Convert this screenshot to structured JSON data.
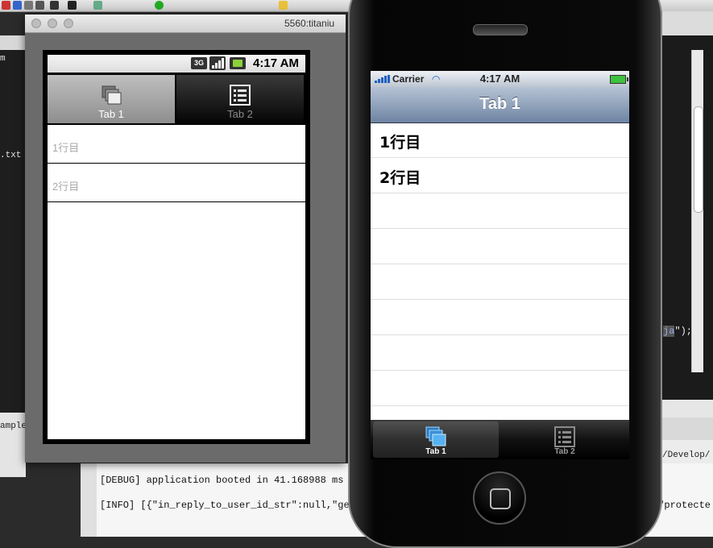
{
  "ide": {
    "left_panel_items": [
      "m",
      ".txt",
      "amples"
    ],
    "code_fragment": {
      "highlight": "ja",
      "rest": "\");"
    },
    "path_fragment": "/Develop/",
    "console": {
      "debug_line": "[DEBUG] application booted in 41.168988 ms",
      "info_line": "[INFO] [{\"in_reply_to_user_id_str\":null,\"geo",
      "info_line_tail": ",\"protecte"
    }
  },
  "emulator": {
    "window_title": "5560:titaniu",
    "status": {
      "network": "3G",
      "time": "4:17 AM"
    },
    "tabs": [
      {
        "label": "Tab 1",
        "icon": "windows-icon",
        "active": true
      },
      {
        "label": "Tab 2",
        "icon": "list-icon",
        "active": false
      }
    ],
    "rows": [
      "1行目",
      "2行目"
    ]
  },
  "iphone": {
    "status": {
      "carrier": "Carrier",
      "time": "4:17 AM"
    },
    "nav_title": "Tab 1",
    "rows": [
      "1行目",
      "2行目",
      "",
      "",
      "",
      "",
      "",
      ""
    ],
    "tabs": [
      {
        "label": "Tab 1",
        "icon": "windows-icon",
        "active": true
      },
      {
        "label": "Tab 2",
        "icon": "list-icon",
        "active": false
      }
    ]
  },
  "colors": {
    "ios_nav": "#6e84a3",
    "ios_tab_active": "#4aa3e0",
    "android_battery": "#8bd13a"
  }
}
